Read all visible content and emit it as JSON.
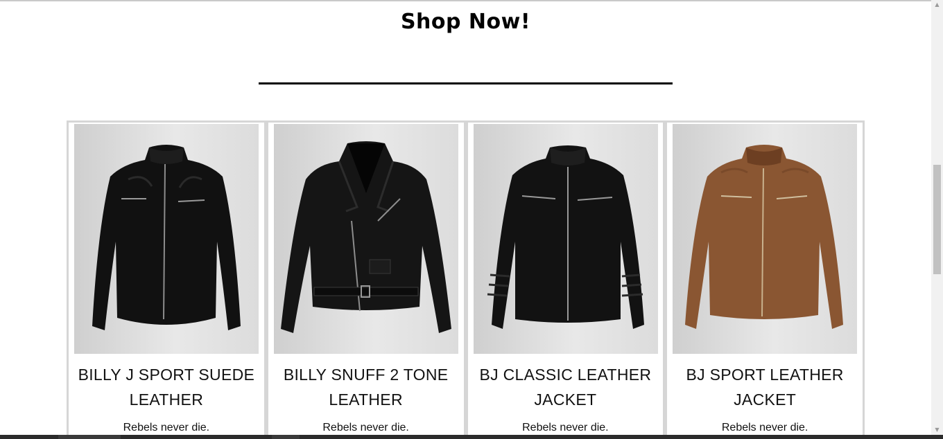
{
  "section": {
    "heading": "Shop Now!"
  },
  "products": [
    {
      "title": "BILLY J SPORT SUEDE LEATHER",
      "tagline": "Rebels never die.",
      "color": "#111111"
    },
    {
      "title": "BILLY SNUFF 2 TONE LEATHER",
      "tagline": "Rebels never die.",
      "color": "#151515"
    },
    {
      "title": "BJ CLASSIC LEATHER JACKET",
      "tagline": "Rebels never die.",
      "color": "#121212"
    },
    {
      "title": "BJ SPORT LEATHER JACKET",
      "tagline": "Rebels never die.",
      "color": "#8a5632"
    }
  ],
  "icons": {
    "scroll_up": "chevron-up-icon",
    "scroll_down": "chevron-down-icon"
  }
}
